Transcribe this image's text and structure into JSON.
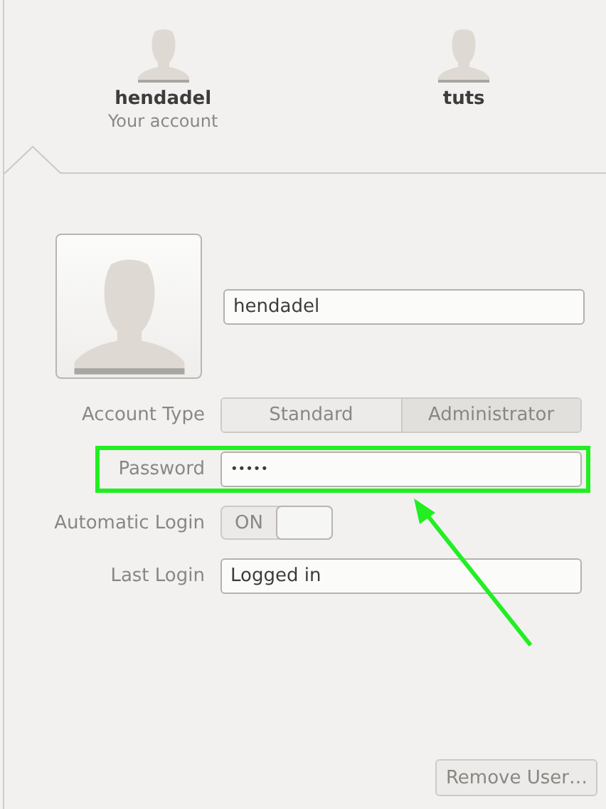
{
  "users": [
    {
      "name": "hendadel",
      "subtitle": "Your account"
    },
    {
      "name": "tuts"
    }
  ],
  "account": {
    "name": "hendadel",
    "account_type": {
      "label": "Account Type",
      "options": [
        {
          "label": "Standard",
          "selected": false
        },
        {
          "label": "Administrator",
          "selected": true
        }
      ]
    },
    "password": {
      "label": "Password",
      "value": "•••••",
      "highlighted": true
    },
    "automatic_login": {
      "label": "Automatic Login",
      "state_text": "ON",
      "on": true
    },
    "last_login": {
      "label": "Last Login",
      "value": "Logged in"
    }
  },
  "remove_button": "Remove User…"
}
